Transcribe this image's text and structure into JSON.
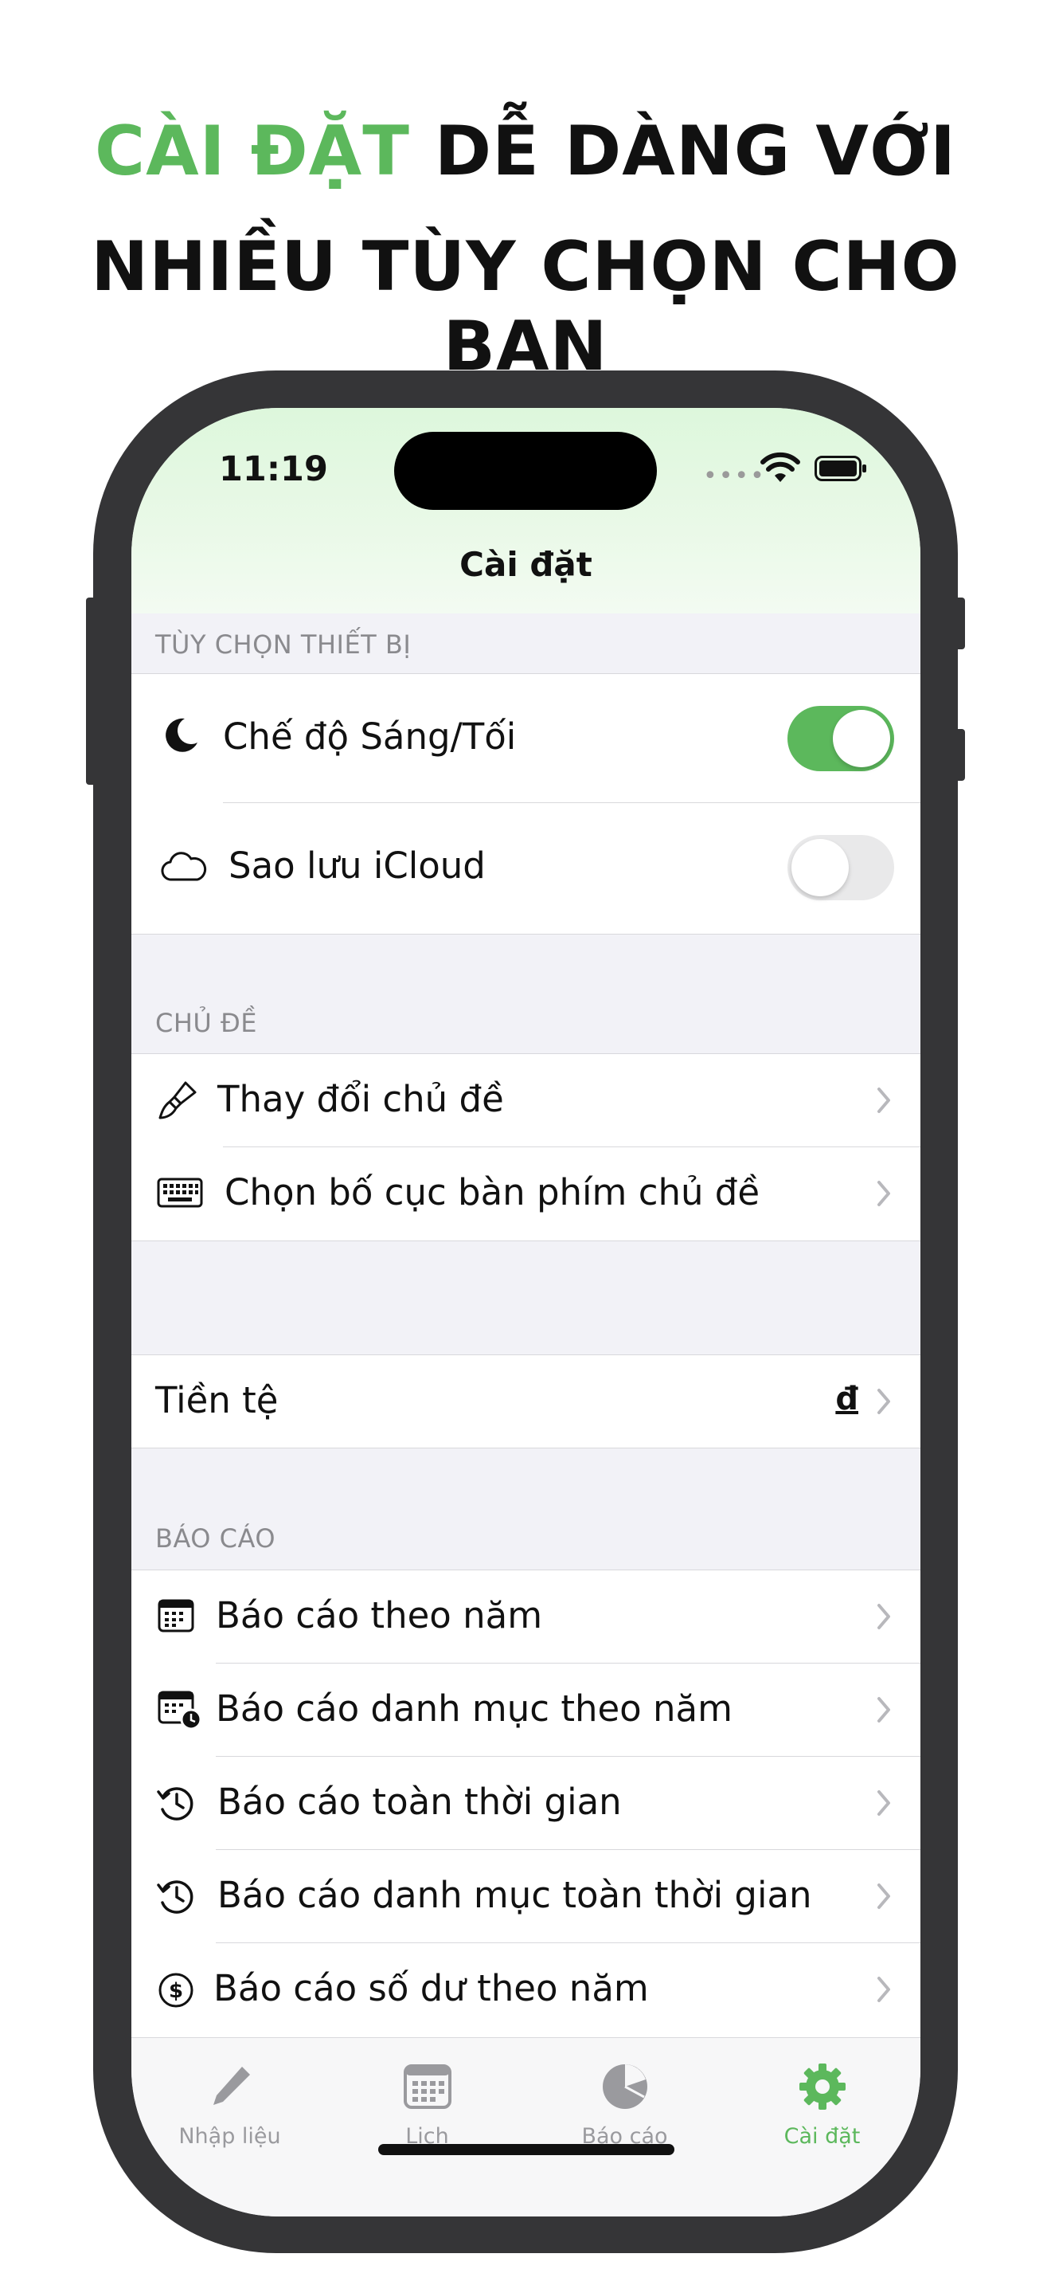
{
  "headline": {
    "line1_accent": "CÀI ĐẶT",
    "line1_rest": " DỄ DÀNG VỚI",
    "line2": "NHIỀU TÙY CHỌN CHO BẠN",
    "accent_color": "#5cb85c"
  },
  "status_bar": {
    "time": "11:19"
  },
  "nav": {
    "title": "Cài đặt"
  },
  "sections": {
    "device": {
      "header": "TÙY CHỌN THIẾT BỊ",
      "rows": [
        {
          "label": "Chế độ Sáng/Tối",
          "icon": "moon-icon",
          "toggle": true
        },
        {
          "label": "Sao lưu iCloud",
          "icon": "cloud-icon",
          "toggle": false
        }
      ]
    },
    "theme": {
      "header": "CHỦ ĐỀ",
      "rows": [
        {
          "label": "Thay đổi chủ đề",
          "icon": "paintbrush-icon"
        },
        {
          "label": "Chọn bố cục bàn phím chủ đề",
          "icon": "keyboard-icon"
        }
      ]
    },
    "currency": {
      "rows": [
        {
          "label": "Tiền tệ",
          "value": "đ"
        }
      ]
    },
    "reports": {
      "header": "BÁO CÁO",
      "rows": [
        {
          "label": "Báo cáo theo năm",
          "icon": "calendar-icon"
        },
        {
          "label": "Báo cáo danh mục theo năm",
          "icon": "calendar-clock-icon"
        },
        {
          "label": "Báo cáo toàn thời gian",
          "icon": "history-icon"
        },
        {
          "label": "Báo cáo danh mục toàn thời gian",
          "icon": "history-icon"
        },
        {
          "label": "Báo cáo số dư theo năm",
          "icon": "dollar-circle-icon"
        }
      ]
    }
  },
  "tabbar": {
    "tabs": [
      {
        "label": "Nhập liệu",
        "icon": "pencil-icon",
        "active": false
      },
      {
        "label": "Lịch",
        "icon": "calendar-icon",
        "active": false
      },
      {
        "label": "Báo cáo",
        "icon": "pie-chart-icon",
        "active": false
      },
      {
        "label": "Cài đặt",
        "icon": "gear-icon",
        "active": true
      }
    ]
  },
  "colors": {
    "accent": "#5cb85c",
    "frame": "#353537",
    "grouped_bg": "#f2f2f7"
  }
}
